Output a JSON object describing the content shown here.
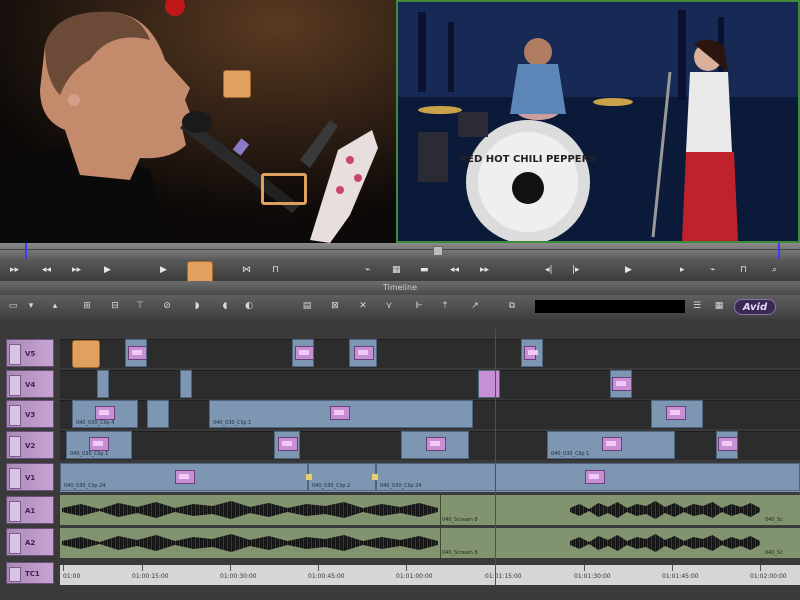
{
  "timeline_title": "Timeline",
  "brand": "Avid",
  "tracks": {
    "v5": "V5",
    "v4": "V4",
    "v3": "V3",
    "v2": "V2",
    "v1": "V1",
    "a1": "A1",
    "a2": "A2",
    "tc": "TC1"
  },
  "clips": {
    "v3_a": "040_030_Clip 4",
    "v3_b": "040_030_Clip 1",
    "v2_a": "040_030_Clip 1",
    "v2_b": "040_030_Clip 1",
    "v1_a": "040_030_Clip 24",
    "v1_b": "040_030_Clip 2",
    "v1_c": "040_030_Clip 24",
    "a1": "040_Scream 8",
    "a1_end": "040_Sc",
    "a2": "040_Scream 8",
    "a2_end": "040_Sc"
  },
  "timecodes": [
    "01:00",
    "01:00:15:00",
    "01:00:30:00",
    "01:00:45:00",
    "01:01:00:00",
    "01:01:15:00",
    "01:01:30:00",
    "01:01:45:00",
    "01:02:00:00"
  ],
  "band_text": "RED HOT CHILI PEPPERS",
  "colors": {
    "accent": "#e0a060",
    "record_border": "#3d8a3a",
    "video_clip": "#7d97b3",
    "audio_clip": "#82946f",
    "track_label": "#c8a4d4"
  }
}
